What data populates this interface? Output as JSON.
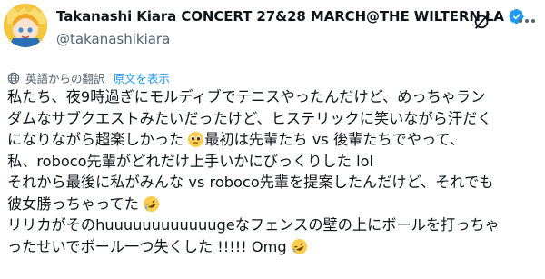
{
  "header": {
    "display_name": "Takanashi Kiara CONCERT 27&28 MARCH@THE WILTERN LA",
    "handle": "@takanashikiara",
    "grok_icon": "grok-icon",
    "more_icon": "more-icon"
  },
  "translation": {
    "label": "英語からの翻訳",
    "show_original": "原文を表示"
  },
  "tweet": {
    "l1": "私たち、夜9時過ぎにモルディブでテニスやったんだけど、めっちゃラン",
    "l2": "ダムなサブクエストみたいだったけど、ヒステリックに笑いながら汗だく",
    "l3": "になりながら超楽しかった",
    "l3b": " 最初は先輩たち vs 後輩たちでやって、",
    "l4": "私、roboco先輩がどれだけ上手いかにびっくりした lol",
    "l5": "それから最後に私がみんな vs roboco先輩を提案したんだけど、それでも",
    "l6": "彼女勝っちゃってた",
    "l7": "リリカがそのhuuuuuuuuuuuugeなフェンスの壁の上にボールを打っちゃ",
    "l8": "ったせいでボール一つ失くした !!!!! Omg"
  },
  "colors": {
    "verified": "#1d9bf0",
    "link": "#1d9bf0",
    "muted": "#536471"
  }
}
